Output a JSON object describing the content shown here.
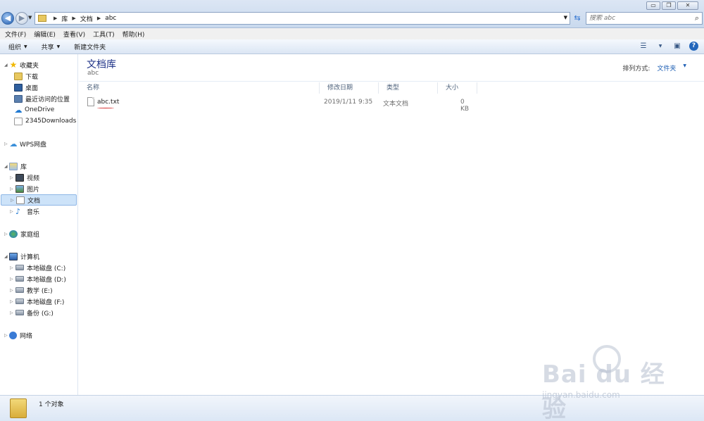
{
  "window": {
    "minimize": "▭",
    "restore": "❐",
    "close": "✕"
  },
  "nav": {
    "back": "◀",
    "forward": "▶"
  },
  "address": {
    "crumbs": [
      "库",
      "文档",
      "abc"
    ]
  },
  "search": {
    "placeholder": "搜索 abc"
  },
  "menu": [
    "文件(F)",
    "编辑(E)",
    "查看(V)",
    "工具(T)",
    "帮助(H)"
  ],
  "commands": {
    "organize": "组织",
    "share": "共享",
    "new_folder": "新建文件夹"
  },
  "sidebar": {
    "favorites": "收藏夹",
    "fav_items": [
      "下载",
      "桌面",
      "最近访问的位置",
      "OneDrive",
      "2345Downloads"
    ],
    "wps": "WPS网盘",
    "libraries": "库",
    "lib_items": [
      "视频",
      "图片",
      "文档",
      "音乐"
    ],
    "homegroup": "家庭组",
    "computer": "计算机",
    "drives": [
      "本地磁盘 (C:)",
      "本地磁盘 (D:)",
      "教学 (E:)",
      "本地磁盘 (F:)",
      "备份 (G:)"
    ],
    "network": "网络"
  },
  "content": {
    "title": "文档库",
    "subtitle": "abc",
    "arrange_label": "排列方式:",
    "arrange_value": "文件夹",
    "columns": [
      "名称",
      "修改日期",
      "类型",
      "大小"
    ],
    "files": [
      {
        "name": "abc.txt",
        "modified": "2019/1/11 9:35",
        "type": "文本文档",
        "size": "0 KB"
      }
    ]
  },
  "status": {
    "count": "1 个对象"
  },
  "watermark": {
    "brand": "Bai du 经验",
    "sub": "jingyan.baidu.com"
  },
  "colors": {
    "accent": "#1e5fb4",
    "selection": "#cde3f9",
    "title": "#1e3287"
  }
}
